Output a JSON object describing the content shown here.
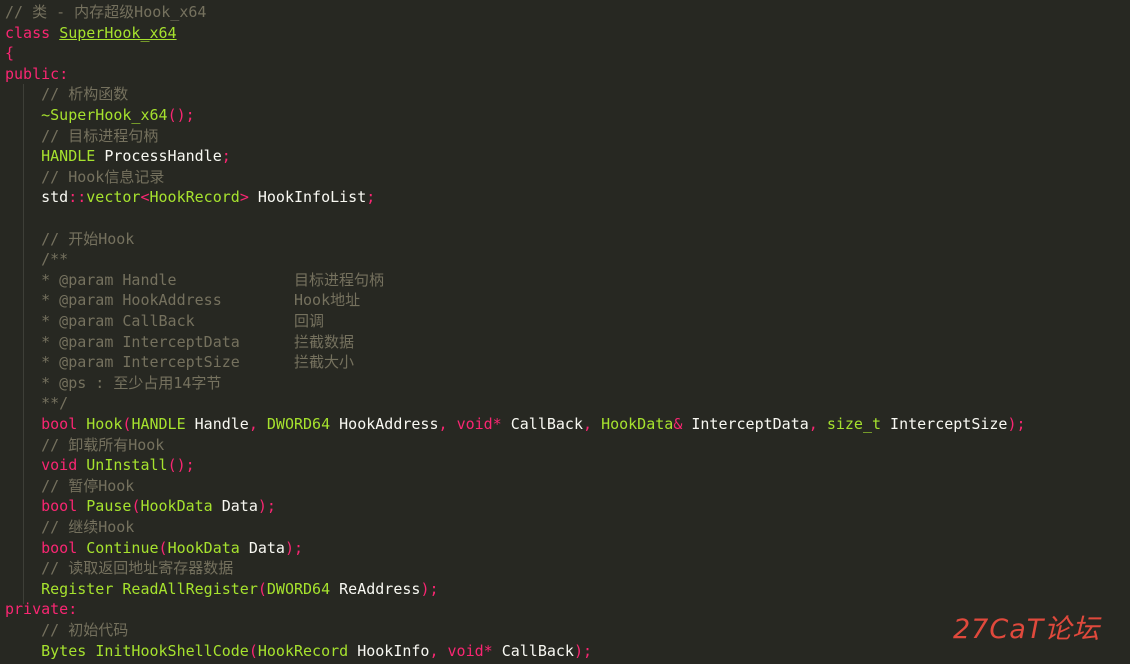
{
  "lines": [
    [
      {
        "c": "cm",
        "t": "// 类 - 内存超级Hook_x64"
      }
    ],
    [
      {
        "c": "kw",
        "t": "class"
      },
      {
        "c": "t",
        "t": " "
      },
      {
        "c": "cls",
        "t": "SuperHook_x64"
      }
    ],
    [
      {
        "c": "kw",
        "t": "{"
      }
    ],
    [
      {
        "c": "kw",
        "t": "public"
      },
      {
        "c": "pn",
        "t": ":"
      }
    ],
    [
      {
        "c": "t",
        "t": "    "
      },
      {
        "c": "cm",
        "t": "// 析构函数"
      }
    ],
    [
      {
        "c": "t",
        "t": "    "
      },
      {
        "c": "fn",
        "t": "~SuperHook_x64"
      },
      {
        "c": "pn",
        "t": "();"
      }
    ],
    [
      {
        "c": "t",
        "t": "    "
      },
      {
        "c": "cm",
        "t": "// 目标进程句柄"
      }
    ],
    [
      {
        "c": "t",
        "t": "    "
      },
      {
        "c": "ty",
        "t": "HANDLE"
      },
      {
        "c": "t",
        "t": " ProcessHandle"
      },
      {
        "c": "pn",
        "t": ";"
      }
    ],
    [
      {
        "c": "t",
        "t": "    "
      },
      {
        "c": "cm",
        "t": "// Hook信息记录"
      }
    ],
    [
      {
        "c": "t",
        "t": "    "
      },
      {
        "c": "t",
        "t": "std"
      },
      {
        "c": "pn",
        "t": "::"
      },
      {
        "c": "ty",
        "t": "vector"
      },
      {
        "c": "pn",
        "t": "<"
      },
      {
        "c": "ty",
        "t": "HookRecord"
      },
      {
        "c": "pn",
        "t": ">"
      },
      {
        "c": "t",
        "t": " HookInfoList"
      },
      {
        "c": "pn",
        "t": ";"
      }
    ],
    [],
    [
      {
        "c": "t",
        "t": "    "
      },
      {
        "c": "cm",
        "t": "// 开始Hook"
      }
    ],
    [
      {
        "c": "t",
        "t": "    "
      },
      {
        "c": "cm",
        "t": "/**"
      }
    ],
    [
      {
        "c": "t",
        "t": "    "
      },
      {
        "c": "cm",
        "t": "* @param Handle             目标进程句柄"
      }
    ],
    [
      {
        "c": "t",
        "t": "    "
      },
      {
        "c": "cm",
        "t": "* @param HookAddress        Hook地址"
      }
    ],
    [
      {
        "c": "t",
        "t": "    "
      },
      {
        "c": "cm",
        "t": "* @param CallBack           回调"
      }
    ],
    [
      {
        "c": "t",
        "t": "    "
      },
      {
        "c": "cm",
        "t": "* @param InterceptData      拦截数据"
      }
    ],
    [
      {
        "c": "t",
        "t": "    "
      },
      {
        "c": "cm",
        "t": "* @param InterceptSize      拦截大小"
      }
    ],
    [
      {
        "c": "t",
        "t": "    "
      },
      {
        "c": "cm",
        "t": "* @ps : 至少占用14字节"
      }
    ],
    [
      {
        "c": "t",
        "t": "    "
      },
      {
        "c": "cm",
        "t": "**/"
      }
    ],
    [
      {
        "c": "t",
        "t": "    "
      },
      {
        "c": "kw",
        "t": "bool"
      },
      {
        "c": "t",
        "t": " "
      },
      {
        "c": "fn",
        "t": "Hook"
      },
      {
        "c": "pn",
        "t": "("
      },
      {
        "c": "ty",
        "t": "HANDLE"
      },
      {
        "c": "t",
        "t": " Handle"
      },
      {
        "c": "pn",
        "t": ","
      },
      {
        "c": "t",
        "t": " "
      },
      {
        "c": "ty",
        "t": "DWORD64"
      },
      {
        "c": "t",
        "t": " HookAddress"
      },
      {
        "c": "pn",
        "t": ","
      },
      {
        "c": "t",
        "t": " "
      },
      {
        "c": "kw",
        "t": "void*"
      },
      {
        "c": "t",
        "t": " CallBack"
      },
      {
        "c": "pn",
        "t": ","
      },
      {
        "c": "t",
        "t": " "
      },
      {
        "c": "ty",
        "t": "HookData"
      },
      {
        "c": "pn",
        "t": "&"
      },
      {
        "c": "t",
        "t": " InterceptData"
      },
      {
        "c": "pn",
        "t": ","
      },
      {
        "c": "t",
        "t": " "
      },
      {
        "c": "ty",
        "t": "size_t"
      },
      {
        "c": "t",
        "t": " InterceptSize"
      },
      {
        "c": "pn",
        "t": ");"
      }
    ],
    [
      {
        "c": "t",
        "t": "    "
      },
      {
        "c": "cm",
        "t": "// 卸载所有Hook"
      }
    ],
    [
      {
        "c": "t",
        "t": "    "
      },
      {
        "c": "kw",
        "t": "void"
      },
      {
        "c": "t",
        "t": " "
      },
      {
        "c": "fn",
        "t": "UnInstall"
      },
      {
        "c": "pn",
        "t": "();"
      }
    ],
    [
      {
        "c": "t",
        "t": "    "
      },
      {
        "c": "cm",
        "t": "// 暂停Hook"
      }
    ],
    [
      {
        "c": "t",
        "t": "    "
      },
      {
        "c": "kw",
        "t": "bool"
      },
      {
        "c": "t",
        "t": " "
      },
      {
        "c": "fn",
        "t": "Pause"
      },
      {
        "c": "pn",
        "t": "("
      },
      {
        "c": "ty",
        "t": "HookData"
      },
      {
        "c": "t",
        "t": " Data"
      },
      {
        "c": "pn",
        "t": ");"
      }
    ],
    [
      {
        "c": "t",
        "t": "    "
      },
      {
        "c": "cm",
        "t": "// 继续Hook"
      }
    ],
    [
      {
        "c": "t",
        "t": "    "
      },
      {
        "c": "kw",
        "t": "bool"
      },
      {
        "c": "t",
        "t": " "
      },
      {
        "c": "fn",
        "t": "Continue"
      },
      {
        "c": "pn",
        "t": "("
      },
      {
        "c": "ty",
        "t": "HookData"
      },
      {
        "c": "t",
        "t": " Data"
      },
      {
        "c": "pn",
        "t": ");"
      }
    ],
    [
      {
        "c": "t",
        "t": "    "
      },
      {
        "c": "cm",
        "t": "// 读取返回地址寄存器数据"
      }
    ],
    [
      {
        "c": "t",
        "t": "    "
      },
      {
        "c": "ty",
        "t": "Register"
      },
      {
        "c": "t",
        "t": " "
      },
      {
        "c": "fn",
        "t": "ReadAllRegister"
      },
      {
        "c": "pn",
        "t": "("
      },
      {
        "c": "ty",
        "t": "DWORD64"
      },
      {
        "c": "t",
        "t": " ReAddress"
      },
      {
        "c": "pn",
        "t": ");"
      }
    ],
    [
      {
        "c": "kw",
        "t": "private"
      },
      {
        "c": "pn",
        "t": ":"
      }
    ],
    [
      {
        "c": "t",
        "t": "    "
      },
      {
        "c": "cm",
        "t": "// 初始代码"
      }
    ],
    [
      {
        "c": "t",
        "t": "    "
      },
      {
        "c": "ty",
        "t": "Bytes"
      },
      {
        "c": "t",
        "t": " "
      },
      {
        "c": "fn",
        "t": "InitHookShellCode"
      },
      {
        "c": "pn",
        "t": "("
      },
      {
        "c": "ty",
        "t": "HookRecord"
      },
      {
        "c": "t",
        "t": " HookInfo"
      },
      {
        "c": "pn",
        "t": ","
      },
      {
        "c": "t",
        "t": " "
      },
      {
        "c": "kw",
        "t": "void*"
      },
      {
        "c": "t",
        "t": " CallBack"
      },
      {
        "c": "pn",
        "t": ");"
      }
    ]
  ],
  "watermark": "27CaT论坛",
  "colors": {
    "background": "#272822",
    "keyword": "#f92672",
    "type": "#a6e22e",
    "comment": "#75715e",
    "text": "#f8f8f2",
    "watermark": "#e0493c"
  }
}
